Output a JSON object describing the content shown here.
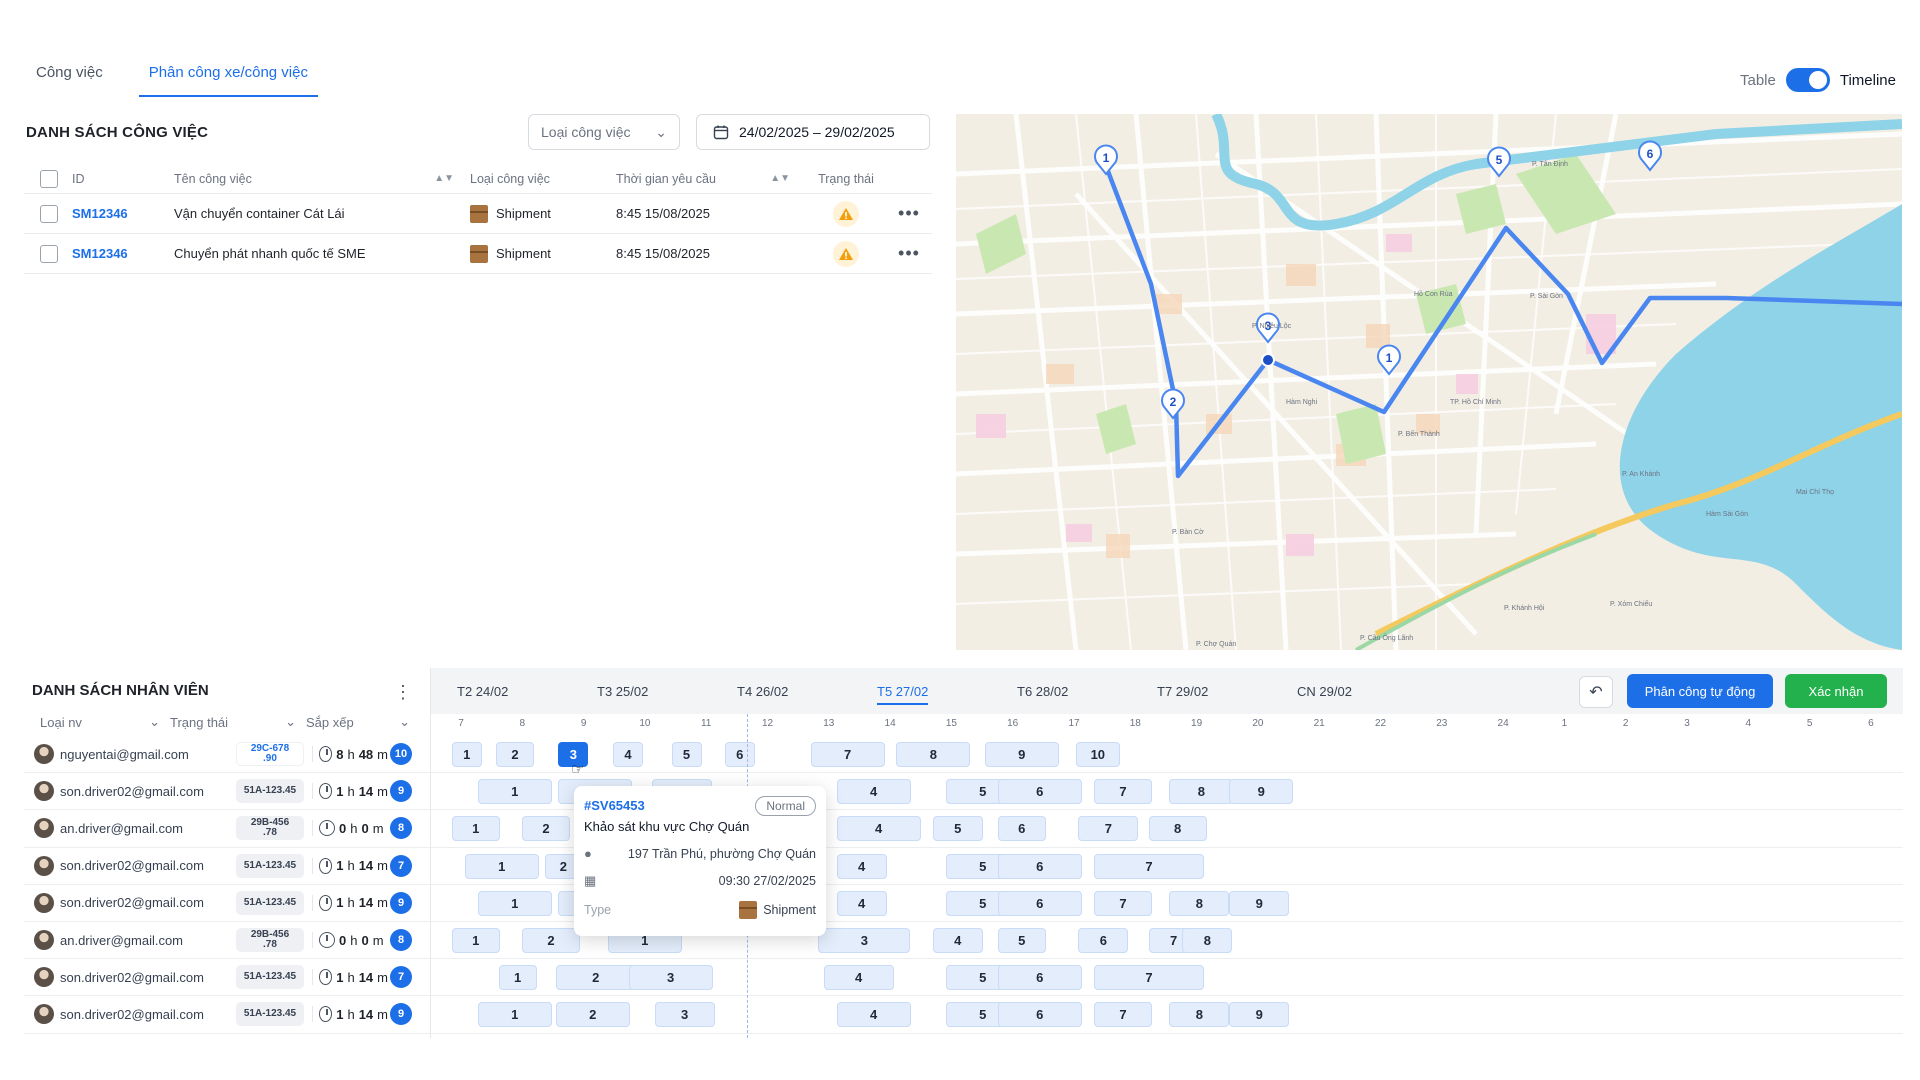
{
  "tabs": [
    {
      "label": "Công việc",
      "active": false
    },
    {
      "label": "Phân công xe/công việc",
      "active": true
    }
  ],
  "view_toggle": {
    "left_label": "Table",
    "right_label": "Timeline",
    "on": true
  },
  "job_list": {
    "title": "DANH SÁCH CÔNG VIỆC",
    "type_filter_placeholder": "Loại công việc",
    "date_range": "24/02/2025 – 29/02/2025",
    "columns": [
      "ID",
      "Tên công việc",
      "Loại công việc",
      "Thời gian yêu cầu",
      "Trạng thái"
    ],
    "rows": [
      {
        "id": "SM12346",
        "name": "Vận chuyển container Cát Lái",
        "type": "Shipment",
        "time": "8:45 15/08/2025",
        "status": "warning"
      },
      {
        "id": "SM12346",
        "name": "Chuyển phát nhanh quốc tế SME",
        "type": "Shipment",
        "time": "8:45 15/08/2025",
        "status": "warning"
      }
    ]
  },
  "map": {
    "route_color": "#4a86f0",
    "markers": [
      "1",
      "2",
      "3",
      "1",
      "5",
      "6"
    ],
    "place_labels": [
      "P. Tân Định",
      "P. Sài Gòn",
      "Hồ Con Rùa",
      "P. Nhiêu Lộc",
      "P. Bến Thành",
      "P. Bàn Cờ",
      "P. An Khánh",
      "P. Xóm Chiếu",
      "P. Chợ Quán",
      "P. Cầu Ông Lãnh",
      "P. Khánh Hội",
      "Mai Chí Thọ",
      "Hàm Nghi",
      "Hàm Sài Gòn",
      "TP. Hồ Chí Minh"
    ]
  },
  "employee_list": {
    "title": "DANH SÁCH NHÂN VIÊN",
    "filters": [
      "Loại nv",
      "Trạng thái",
      "Sắp xếp"
    ],
    "rows": [
      {
        "email": "nguyentai@gmail.com",
        "plate_top": "29C-678",
        "plate_bottom": ".90",
        "plate_style": "blue",
        "h": "8",
        "m": "48",
        "count": "10"
      },
      {
        "email": "son.driver02@gmail.com",
        "plate_top": "51A-123.45",
        "plate_bottom": "",
        "plate_style": "grey",
        "h": "1",
        "m": "14",
        "count": "9"
      },
      {
        "email": "an.driver@gmail.com",
        "plate_top": "29B-456",
        "plate_bottom": ".78",
        "plate_style": "grey",
        "h": "0",
        "m": "0",
        "count": "8"
      },
      {
        "email": "son.driver02@gmail.com",
        "plate_top": "51A-123.45",
        "plate_bottom": "",
        "plate_style": "grey",
        "h": "1",
        "m": "14",
        "count": "7"
      },
      {
        "email": "son.driver02@gmail.com",
        "plate_top": "51A-123.45",
        "plate_bottom": "",
        "plate_style": "grey",
        "h": "1",
        "m": "14",
        "count": "9"
      },
      {
        "email": "an.driver@gmail.com",
        "plate_top": "29B-456",
        "plate_bottom": ".78",
        "plate_style": "grey",
        "h": "0",
        "m": "0",
        "count": "8"
      },
      {
        "email": "son.driver02@gmail.com",
        "plate_top": "51A-123.45",
        "plate_bottom": "",
        "plate_style": "grey",
        "h": "1",
        "m": "14",
        "count": "7"
      },
      {
        "email": "son.driver02@gmail.com",
        "plate_top": "51A-123.45",
        "plate_bottom": "",
        "plate_style": "grey",
        "h": "1",
        "m": "14",
        "count": "9"
      }
    ]
  },
  "timeline": {
    "days": [
      {
        "label": "T2 24/02",
        "active": false
      },
      {
        "label": "T3 25/02",
        "active": false
      },
      {
        "label": "T4 26/02",
        "active": false
      },
      {
        "label": "T5 27/02",
        "active": true
      },
      {
        "label": "T6 28/02",
        "active": false
      },
      {
        "label": "T7 29/02",
        "active": false
      },
      {
        "label": "CN 29/02",
        "active": false
      }
    ],
    "hours": [
      "7",
      "8",
      "9",
      "10",
      "11",
      "12",
      "13",
      "14",
      "15",
      "16",
      "17",
      "18",
      "19",
      "20",
      "21",
      "22",
      "23",
      "24",
      "1",
      "2",
      "3",
      "4",
      "5",
      "6"
    ],
    "auto_assign_label": "Phân công tự động",
    "confirm_label": "Xác nhận",
    "rows": [
      [
        {
          "n": "1"
        },
        {
          "n": "2"
        },
        {
          "n": "3",
          "selected": true
        },
        {
          "n": "4"
        },
        {
          "n": "5"
        },
        {
          "n": "6"
        },
        {
          "n": "7"
        },
        {
          "n": "8"
        },
        {
          "n": "9"
        },
        {
          "n": "10"
        }
      ],
      [
        {
          "n": "1"
        },
        {
          "n": "2"
        },
        {
          "n": "3"
        },
        {
          "n": "4"
        },
        {
          "n": "5"
        },
        {
          "n": "6"
        },
        {
          "n": "7"
        },
        {
          "n": "8"
        },
        {
          "n": "9"
        }
      ],
      [
        {
          "n": "1"
        },
        {
          "n": "2"
        },
        {
          "n": "3"
        },
        {
          "n": "4"
        },
        {
          "n": "5"
        },
        {
          "n": "6"
        },
        {
          "n": "7"
        },
        {
          "n": "8"
        }
      ],
      [
        {
          "n": "1"
        },
        {
          "n": "2"
        },
        {
          "n": "4"
        },
        {
          "n": "5"
        },
        {
          "n": "6"
        },
        {
          "n": "7"
        }
      ],
      [
        {
          "n": "1"
        },
        {
          "n": "2"
        },
        {
          "n": "4"
        },
        {
          "n": "5"
        },
        {
          "n": "6"
        },
        {
          "n": "7"
        },
        {
          "n": "8"
        },
        {
          "n": "9"
        }
      ],
      [
        {
          "n": "1"
        },
        {
          "n": "2"
        },
        {
          "n": "1"
        },
        {
          "n": "3"
        },
        {
          "n": "4"
        },
        {
          "n": "5"
        },
        {
          "n": "6"
        },
        {
          "n": "7"
        },
        {
          "n": "8"
        }
      ],
      [
        {
          "n": "1"
        },
        {
          "n": "2"
        },
        {
          "n": "3"
        },
        {
          "n": "4"
        },
        {
          "n": "5"
        },
        {
          "n": "6"
        },
        {
          "n": "7"
        }
      ],
      [
        {
          "n": "1"
        },
        {
          "n": "2"
        },
        {
          "n": "3"
        },
        {
          "n": "4"
        },
        {
          "n": "5"
        },
        {
          "n": "6"
        },
        {
          "n": "7"
        },
        {
          "n": "8"
        },
        {
          "n": "9"
        }
      ]
    ]
  },
  "popover": {
    "id": "#SV65453",
    "badge": "Normal",
    "title": "Khảo sát khu vực Chợ Quán",
    "address": "197 Trần Phú, phường Chợ Quán",
    "datetime": "09:30 27/02/2025",
    "type_label": "Type",
    "type_value": "Shipment"
  }
}
